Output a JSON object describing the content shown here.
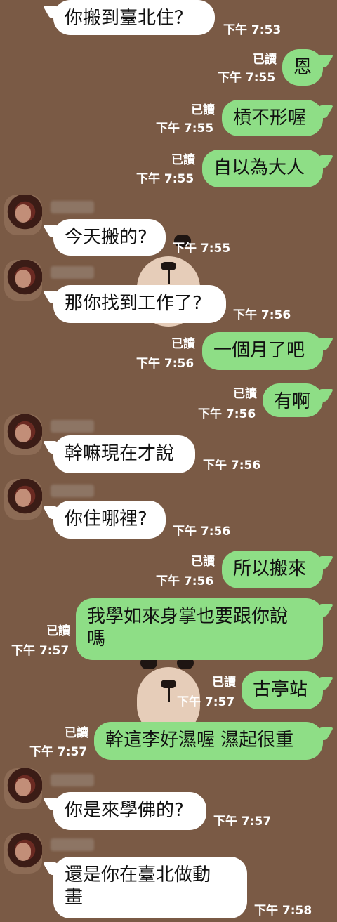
{
  "read_label": "已讀",
  "messages": [
    {
      "side": "in",
      "text": "你搬到臺北住？",
      "time": "下午 7:53"
    },
    {
      "side": "out",
      "text": "恩",
      "time": "下午 7:55",
      "read": "已讀"
    },
    {
      "side": "out",
      "text": "槓不形喔",
      "time": "下午 7:55",
      "read": "已讀"
    },
    {
      "side": "out",
      "text": "自以為大人",
      "time": "下午 7:55",
      "read": "已讀"
    },
    {
      "side": "in",
      "text": "今天搬的?",
      "time": "下午 7:55"
    },
    {
      "side": "in",
      "text": "那你找到工作了?",
      "time": "下午 7:56"
    },
    {
      "side": "out",
      "text": "一個月了吧",
      "time": "下午 7:56",
      "read": "已讀"
    },
    {
      "side": "out",
      "text": "有啊",
      "time": "下午 7:56",
      "read": "已讀"
    },
    {
      "side": "in",
      "text": "幹嘛現在才說",
      "time": "下午 7:56"
    },
    {
      "side": "in",
      "text": "你住哪裡?",
      "time": "下午 7:56"
    },
    {
      "side": "out",
      "text": "所以搬來",
      "time": "下午 7:56",
      "read": "已讀"
    },
    {
      "side": "out",
      "text": "我學如來身掌也要跟你說\n嗎",
      "time": "下午 7:57",
      "read": "已讀"
    },
    {
      "side": "out",
      "text": "古亭站",
      "time": "下午 7:57",
      "read": "已讀"
    },
    {
      "side": "out",
      "text": "幹這李好濕喔 濕起很重",
      "time": "下午 7:57",
      "read": "已讀"
    },
    {
      "side": "in",
      "text": "你是來學佛的?",
      "time": "下午 7:57"
    },
    {
      "side": "in",
      "text": "還是你在臺北做動\n畫",
      "time": "下午 7:58"
    }
  ]
}
